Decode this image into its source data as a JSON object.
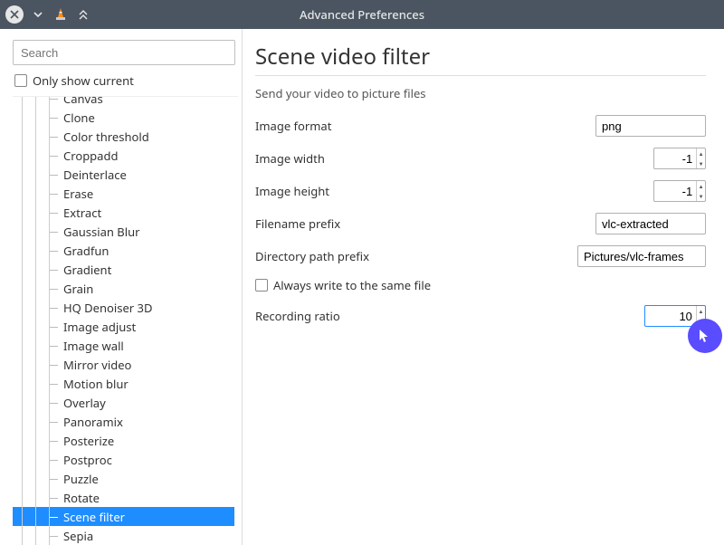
{
  "window": {
    "title": "Advanced Preferences"
  },
  "sidebar": {
    "search_placeholder": "Search",
    "only_show_current_label": "Only show current",
    "items": [
      "Canvas",
      "Clone",
      "Color threshold",
      "Croppadd",
      "Deinterlace",
      "Erase",
      "Extract",
      "Gaussian Blur",
      "Gradfun",
      "Gradient",
      "Grain",
      "HQ Denoiser 3D",
      "Image adjust",
      "Image wall",
      "Mirror video",
      "Motion blur",
      "Overlay",
      "Panoramix",
      "Posterize",
      "Postproc",
      "Puzzle",
      "Rotate",
      "Scene filter",
      "Sepia"
    ],
    "selected_index": 22
  },
  "main": {
    "title": "Scene video filter",
    "subtitle": "Send your video to picture files",
    "fields": {
      "image_format": {
        "label": "Image format",
        "value": "png"
      },
      "image_width": {
        "label": "Image width",
        "value": "-1"
      },
      "image_height": {
        "label": "Image height",
        "value": "-1"
      },
      "filename_prefix": {
        "label": "Filename prefix",
        "value": "vlc-extracted"
      },
      "directory_path_prefix": {
        "label": "Directory path prefix",
        "value": "Pictures/vlc-frames"
      },
      "always_same_file": {
        "label": "Always write to the same file",
        "checked": false
      },
      "recording_ratio": {
        "label": "Recording ratio",
        "value": "10"
      }
    }
  }
}
